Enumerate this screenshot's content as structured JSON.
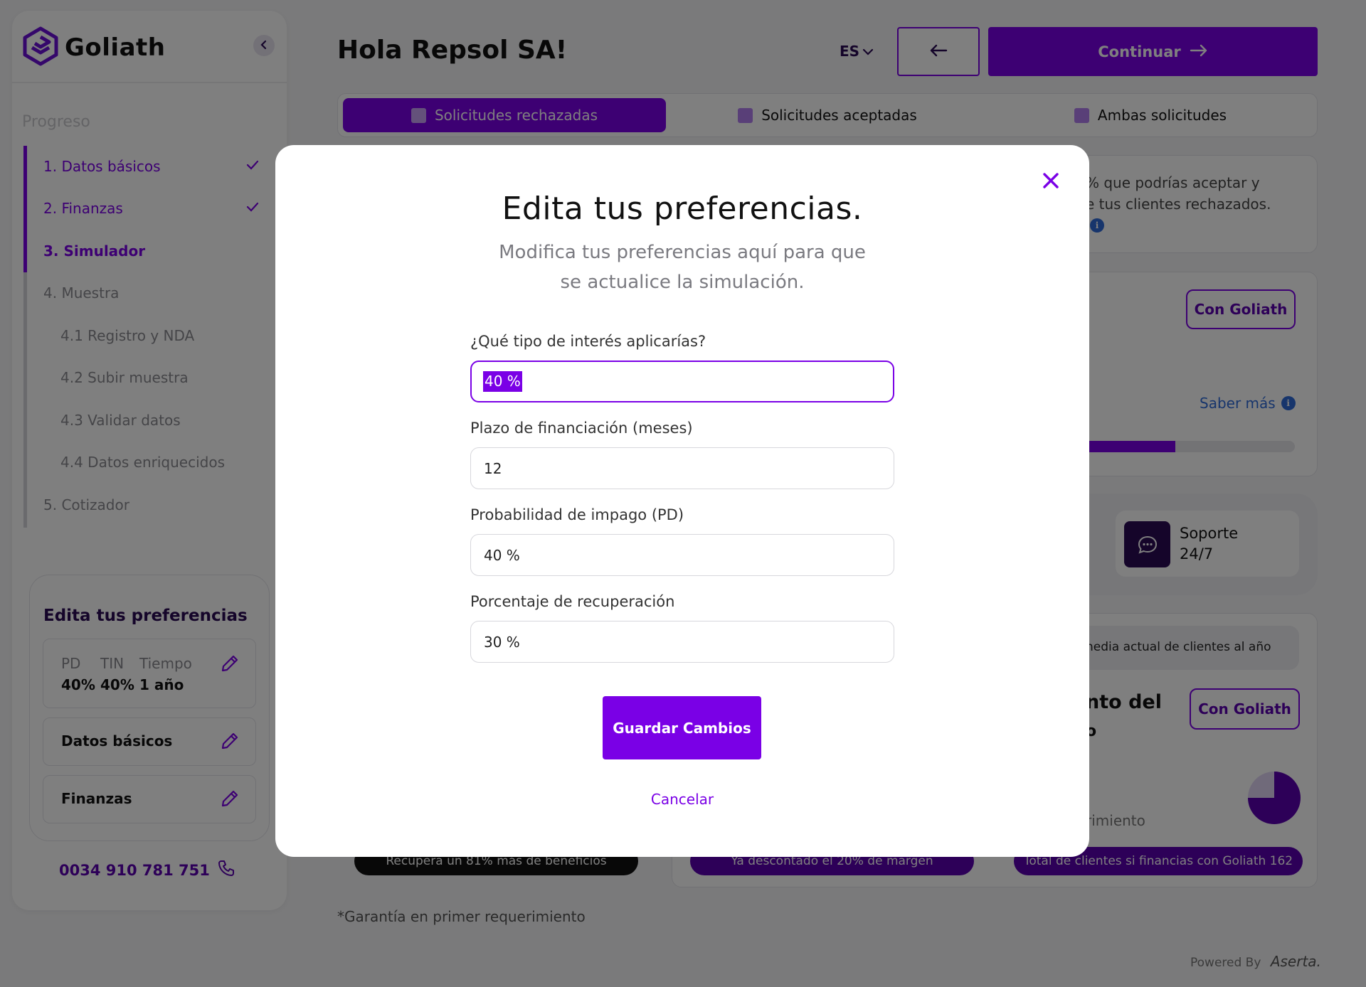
{
  "brand": {
    "name": "Goliath"
  },
  "sidebar": {
    "progress_label": "Progreso",
    "steps": [
      {
        "label": "1.  Datos básicos",
        "state": "done"
      },
      {
        "label": "2.  Finanzas",
        "state": "done"
      },
      {
        "label": "3.  Simulador",
        "state": "current"
      },
      {
        "label": "4.  Muestra",
        "state": "pending"
      },
      {
        "label": "4.1  Registro y NDA",
        "state": "pending"
      },
      {
        "label": "4.2  Subir muestra",
        "state": "pending"
      },
      {
        "label": "4.3  Validar datos",
        "state": "pending"
      },
      {
        "label": "4.4  Datos enriquecidos",
        "state": "pending"
      },
      {
        "label": "5.  Cotizador",
        "state": "pending"
      }
    ],
    "prefs_card": {
      "title": "Edita tus preferencias",
      "headers": [
        "PD",
        "TIN",
        "Tiempo"
      ],
      "values": [
        "40%",
        "40%",
        "1 año"
      ],
      "items": [
        "Datos básicos",
        "Finanzas"
      ]
    },
    "phone": "0034 910 781 751"
  },
  "header": {
    "greeting": "Hola Repsol SA!",
    "language": "ES",
    "continue_label": "Continuar"
  },
  "tabs": [
    {
      "label": "Solicitudes rechazadas",
      "active": true
    },
    {
      "label": "Solicitudes aceptadas",
      "active": false
    },
    {
      "label": "Ambas solicitudes",
      "active": false
    }
  ],
  "background": {
    "info_text_1": "% que podrías aceptar y",
    "info_text_2": "e tus clientes rechazados.",
    "con_goliath_1": "Con Goliath",
    "saber_mas": "Saber más",
    "progress_fraction": 0.44,
    "support": [
      "Soporte",
      "24/7"
    ],
    "media_text": "nedia actual de clientes al año",
    "heading_fragment_1": "nto del",
    "heading_fragment_2": "o",
    "con_goliath_2": "Con Goliath",
    "rimiento": "rimiento",
    "pie_fraction": 0.75,
    "pills": [
      "Recupera un 81% más de beneficios",
      "Ya descontado el 20% de margen",
      "Total de clientes si financias con Goliath 162"
    ],
    "footnote": "*Garantía en primer requerimiento",
    "powered_by": "Powered By",
    "aserta": "Aserta."
  },
  "modal": {
    "title": "Edita tus preferencias.",
    "subtitle_line1": "Modifica tus preferencias aquí para que",
    "subtitle_line2": "se actualice la simulación.",
    "fields": [
      {
        "label": "¿Qué tipo de interés aplicarías?",
        "value": "40 %"
      },
      {
        "label": "Plazo de financiación (meses)",
        "value": "12"
      },
      {
        "label": "Probabilidad de impago (PD)",
        "value": "40 %"
      },
      {
        "label": "Porcentaje de recuperación",
        "value": "30 %"
      }
    ],
    "save_label": "Guardar Cambios",
    "cancel_label": "Cancelar"
  },
  "colors": {
    "accent": "#7a00e6",
    "dark_purple": "#2a0a55",
    "link_blue": "#2f6bd8"
  }
}
